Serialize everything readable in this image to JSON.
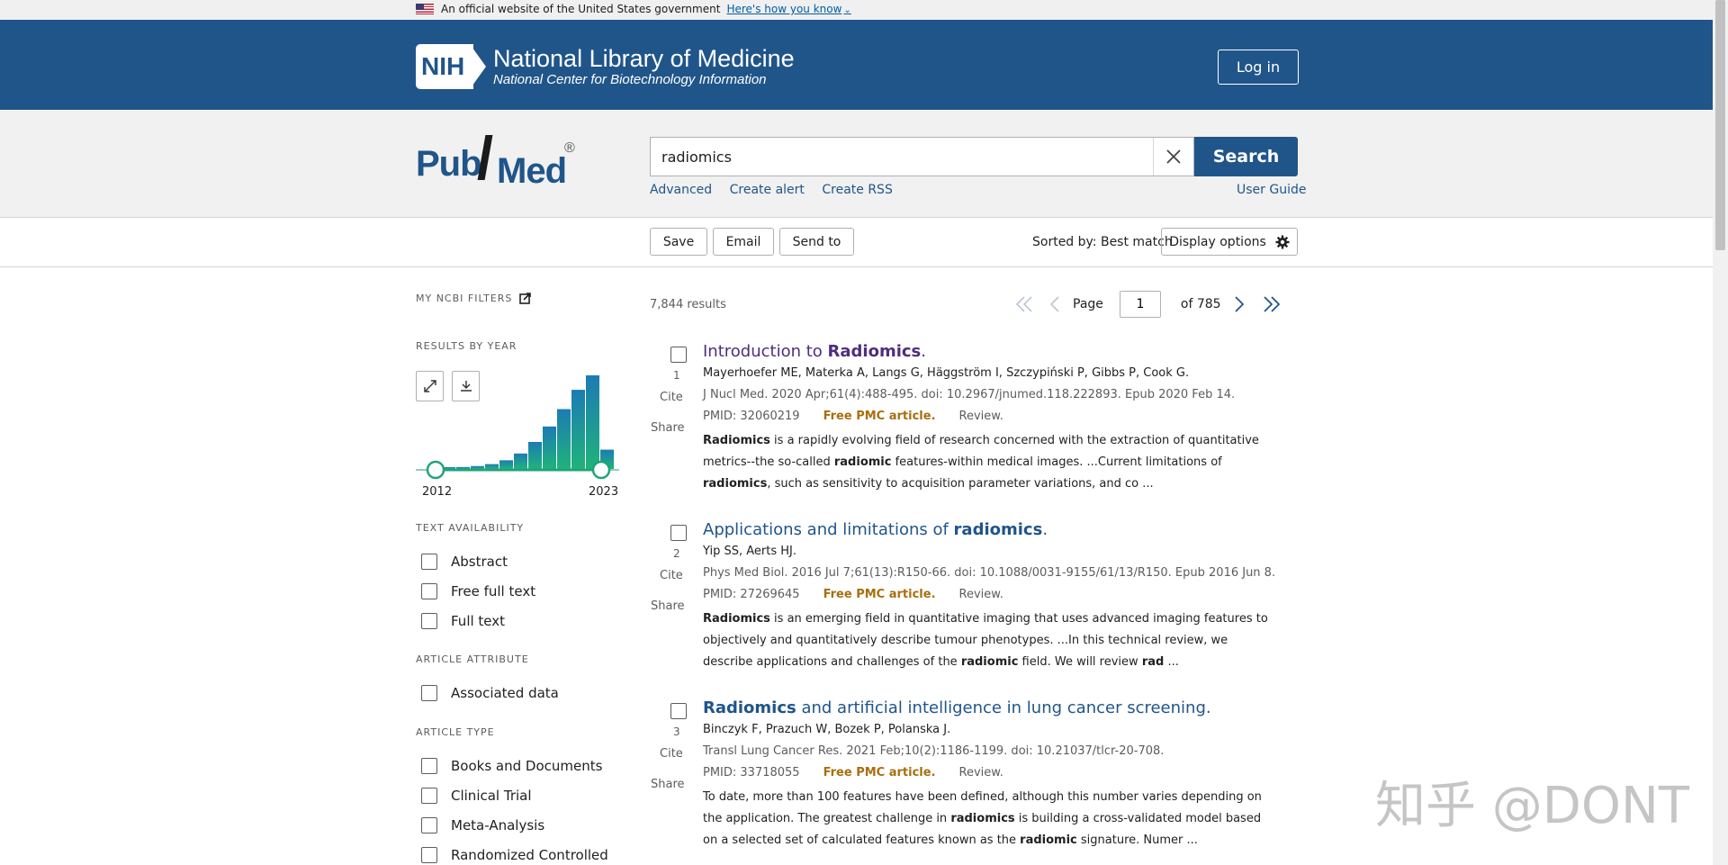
{
  "gov_banner": {
    "text": "An official website of the United States government",
    "link": "Here's how you know"
  },
  "header": {
    "logo_abbr": "NIH",
    "title": "National Library of Medicine",
    "subtitle": "National Center for Biotechnology Information",
    "login": "Log in"
  },
  "search": {
    "logo_pub": "Pub",
    "logo_med": "Med",
    "logo_reg": "®",
    "query": "radiomics",
    "button": "Search",
    "links": [
      "Advanced",
      "Create alert",
      "Create RSS"
    ],
    "user_guide": "User Guide"
  },
  "actions": {
    "save": "Save",
    "email": "Email",
    "send_to": "Send to",
    "sorted": "Sorted by: Best match",
    "display_options": "Display options"
  },
  "sidebar": {
    "my_filters": "MY NCBI FILTERS",
    "results_by_year": "RESULTS BY YEAR",
    "year_start": "2012",
    "year_end": "2023",
    "text_availability": "TEXT AVAILABILITY",
    "text_items": [
      "Abstract",
      "Free full text",
      "Full text"
    ],
    "article_attribute": "ARTICLE ATTRIBUTE",
    "attr_items": [
      "Associated data"
    ],
    "article_type": "ARTICLE TYPE",
    "type_items": [
      "Books and Documents",
      "Clinical Trial",
      "Meta-Analysis",
      "Randomized Controlled"
    ]
  },
  "chart_data": {
    "type": "bar",
    "categories": [
      "2012",
      "2013",
      "2014",
      "2015",
      "2016",
      "2017",
      "2018",
      "2019",
      "2020",
      "2021",
      "2022",
      "2023"
    ],
    "values": [
      1,
      2,
      3,
      5,
      9,
      16,
      28,
      44,
      62,
      82,
      97,
      20
    ],
    "title": "",
    "xlabel": "",
    "ylabel": ""
  },
  "results": {
    "count": "7,844 results",
    "page_label": "Page",
    "page_value": "1",
    "of_pages": "of 785",
    "articles": [
      {
        "num": "1",
        "cite": "Cite",
        "share": "Share",
        "title_pre": "Introduction to ",
        "title_bold": "Radiomics",
        "title_post": ".",
        "authors": "Mayerhoefer ME, Materka A, Langs G, Häggström I, Szczypiński P, Gibbs P, Cook G.",
        "journal": "J Nucl Med. 2020 Apr;61(4):488-495. doi: 10.2967/jnumed.118.222893. Epub 2020 Feb 14.",
        "pmid": "PMID: 32060219",
        "free": "Free PMC article.",
        "review": "Review.",
        "s1b": "Radiomics",
        "s1": " is a rapidly evolving field of research concerned with the extraction of quantitative metrics--the so-called ",
        "s2b": "radiomic",
        "s2": " features-within medical images. ...Current limitations of ",
        "s3b": "radiomics",
        "s3": ", such as sensitivity to acquisition parameter variations, and co ..."
      },
      {
        "num": "2",
        "cite": "Cite",
        "share": "Share",
        "title_pre": "Applications and limitations of ",
        "title_bold": "radiomics",
        "title_post": ".",
        "authors": "Yip SS, Aerts HJ.",
        "journal": "Phys Med Biol. 2016 Jul 7;61(13):R150-66. doi: 10.1088/0031-9155/61/13/R150. Epub 2016 Jun 8.",
        "pmid": "PMID: 27269645",
        "free": "Free PMC article.",
        "review": "Review.",
        "s1b": "Radiomics",
        "s1": " is an emerging field in quantitative imaging that uses advanced imaging features to objectively and quantitatively describe tumour phenotypes. ...In this technical review, we describe applications and challenges of the ",
        "s2b": "radiomic",
        "s2": " field. We will review ",
        "s3b": "rad",
        "s3": " ..."
      },
      {
        "num": "3",
        "cite": "Cite",
        "share": "Share",
        "title_pre": "",
        "title_bold": "Radiomics",
        "title_post": " and artificial intelligence in lung cancer screening.",
        "authors": "Binczyk F, Prazuch W, Bozek P, Polanska J.",
        "journal": "Transl Lung Cancer Res. 2021 Feb;10(2):1186-1199. doi: 10.21037/tlcr-20-708.",
        "pmid": "PMID: 33718055",
        "free": "Free PMC article.",
        "review": "Review.",
        "s1b": "",
        "s1": "To date, more than 100 features have been defined, although this number varies depending on the application. The greatest challenge in ",
        "s2b": "radiomics",
        "s2": " is building a cross-validated model based on a selected set of calculated features known as the ",
        "s3b": "radiomic",
        "s3": " signature. Numer ..."
      }
    ]
  },
  "watermark": "知乎 @DONT"
}
